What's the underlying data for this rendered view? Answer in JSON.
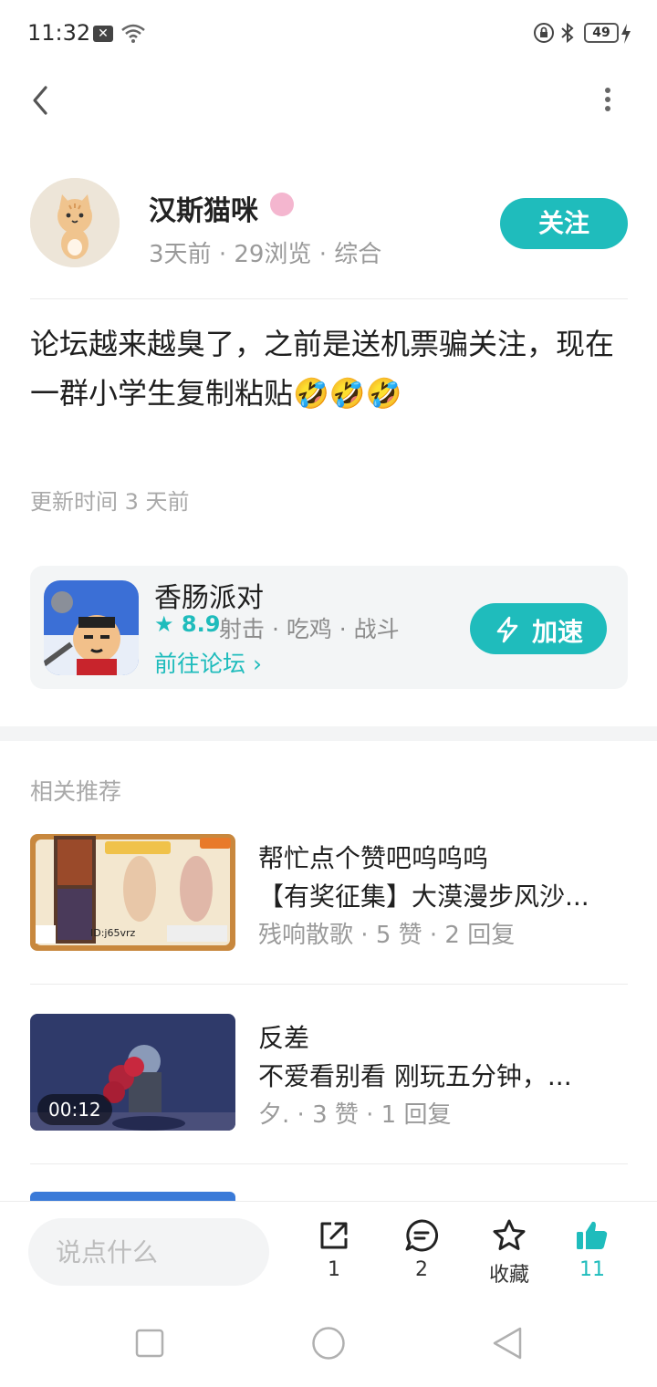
{
  "status_bar": {
    "time": "11:32",
    "battery": "49",
    "icons": [
      "close-notification-icon",
      "wifi-icon",
      "lock-rotation-icon",
      "bluetooth-icon",
      "battery-icon",
      "charging-icon"
    ]
  },
  "header": {
    "back_icon": "chevron-left-icon",
    "more_icon": "more-vertical-icon"
  },
  "author": {
    "name": "汉斯猫咪",
    "meta_time": "3天前",
    "meta_views": "29浏览",
    "meta_category": "综合",
    "follow_label": "关注"
  },
  "post": {
    "text": "论坛越来越臭了，之前是送机票骗关注，现在一群小学生复制粘贴🤣🤣🤣",
    "update_time": "更新时间 3 天前"
  },
  "game": {
    "name": "香肠派对",
    "rating": "8.9",
    "tags": "射击 · 吃鸡 · 战斗",
    "forum_link": "前往论坛",
    "speed_label": "加速"
  },
  "recommend": {
    "title": "相关推荐",
    "items": [
      {
        "title": "帮忙点个赞吧呜呜呜",
        "subtitle": "【有奖征集】大漠漫步风沙...",
        "author": "残响散歌",
        "likes": "5 赞",
        "replies": "2 回复",
        "thumb_text": "ID:j65vrz"
      },
      {
        "title": "反差",
        "subtitle": "不爱看别看  刚玩五分钟，...",
        "author": "夕.",
        "likes": "3 赞",
        "replies": "1 回复",
        "duration": "00:12"
      }
    ]
  },
  "bottom_bar": {
    "comment_placeholder": "说点什么",
    "share_count": "1",
    "comment_count": "2",
    "favorite_label": "收藏",
    "like_count": "11"
  },
  "colors": {
    "accent": "#1fbcbc",
    "text_primary": "#1f1f1f",
    "text_secondary": "#9a9a9a"
  }
}
